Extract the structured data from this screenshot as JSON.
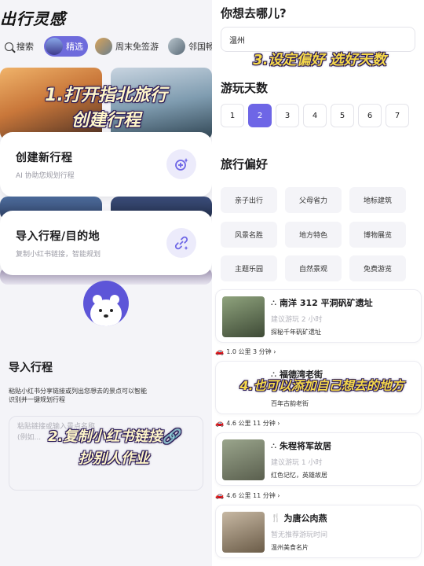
{
  "left": {
    "app_title": "出行灵感",
    "chips": {
      "search": "搜索",
      "featured": "精选",
      "weekend": "周末免签游",
      "nearby": "邻国畅"
    },
    "overlay_step1": [
      "1.打开指北旅行",
      "创建行程"
    ],
    "create_card": {
      "title": "创建新行程",
      "subtitle": "AI 协助您规划行程",
      "icon": "sparkle-plus-icon"
    },
    "import_card": {
      "title": "导入行程/目的地",
      "subtitle": "复制小红书链接，智能规划",
      "icon": "link-icon"
    },
    "import_section": {
      "title": "导入行程",
      "description": "粘贴小红书分享链接或列出您想去的景点可以智能识别并一键规划行程",
      "placeholder_line1": "粘贴链接或输入景点名称",
      "placeholder_line2": "(例如..."
    },
    "overlay_step2": [
      "2.复制小红书链接🔗",
      "抄别人作业"
    ]
  },
  "right": {
    "question": "你想去哪儿?",
    "destination": "温州",
    "overlay_step3": "3.设定偏好 选好天数",
    "days_title": "游玩天数",
    "days": [
      "1",
      "2",
      "3",
      "4",
      "5",
      "6",
      "7"
    ],
    "selected_day": "2",
    "prefs_title": "旅行偏好",
    "prefs": [
      "亲子出行",
      "父母省力",
      "地标建筑",
      "风景名胜",
      "地方特色",
      "博物展览",
      "主题乐园",
      "自然景观",
      "免费游览"
    ],
    "spots": [
      {
        "name": "南洋 312 平洞矾矿遗址",
        "icon": "attraction-icon",
        "hint": "建议游玩 2 小时",
        "desc": "探秘千年矾矿遗址"
      },
      {
        "name": "福德湾老街",
        "icon": "attraction-icon",
        "hint": "",
        "desc": "百年古韵老街"
      },
      {
        "name": "朱程将军故居",
        "icon": "attraction-icon",
        "hint": "建议游玩 1 小时",
        "desc": "红色记忆，英雄故居"
      },
      {
        "name": "为唐公肉燕",
        "icon": "food-icon",
        "hint": "暂无推荐游玩时间",
        "desc": "温州美食名片"
      }
    ],
    "routes": [
      "1.0 公里 3 分钟",
      "4.6 公里 11 分钟",
      "4.6 公里 11 分钟"
    ],
    "overlay_step4": "4.也可以添加自己想去的地方"
  },
  "colors": {
    "accent": "#6e66e6",
    "accent_light": "#ecebfb",
    "overlay_text": "#f5d84a"
  }
}
